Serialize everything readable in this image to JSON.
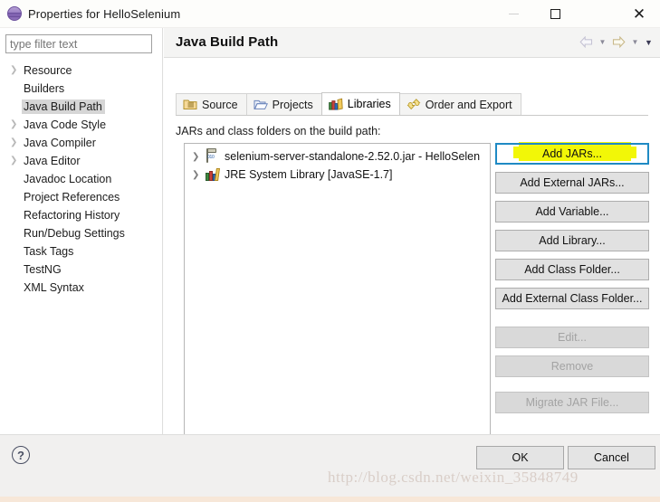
{
  "window": {
    "title": "Properties for HelloSelenium",
    "icon": "eclipse-sphere-icon",
    "minimize_label": "–",
    "maximize_label": "☐",
    "close_label": "✕"
  },
  "sidebar": {
    "filter": {
      "value": "",
      "placeholder": "type filter text"
    },
    "items": [
      {
        "label": "Resource",
        "expandable": true,
        "selected": false
      },
      {
        "label": "Builders",
        "expandable": false,
        "selected": false
      },
      {
        "label": "Java Build Path",
        "expandable": false,
        "selected": true
      },
      {
        "label": "Java Code Style",
        "expandable": true,
        "selected": false
      },
      {
        "label": "Java Compiler",
        "expandable": true,
        "selected": false
      },
      {
        "label": "Java Editor",
        "expandable": true,
        "selected": false
      },
      {
        "label": "Javadoc Location",
        "expandable": false,
        "selected": false
      },
      {
        "label": "Project References",
        "expandable": false,
        "selected": false
      },
      {
        "label": "Refactoring History",
        "expandable": false,
        "selected": false
      },
      {
        "label": "Run/Debug Settings",
        "expandable": false,
        "selected": false
      },
      {
        "label": "Task Tags",
        "expandable": false,
        "selected": false
      },
      {
        "label": "TestNG",
        "expandable": false,
        "selected": false
      },
      {
        "label": "XML Syntax",
        "expandable": false,
        "selected": false
      }
    ]
  },
  "page": {
    "title": "Java Build Path",
    "nav": {
      "back_icon": "back-arrow-icon",
      "back_caret": "▼",
      "forward_icon": "forward-arrow-icon",
      "forward_caret": "▼",
      "menu_caret": "▼"
    }
  },
  "tabs": [
    {
      "label": "Source",
      "icon": "source-folder-icon",
      "active": false
    },
    {
      "label": "Projects",
      "icon": "open-folder-icon",
      "active": false
    },
    {
      "label": "Libraries",
      "icon": "books-icon",
      "active": true
    },
    {
      "label": "Order and Export",
      "icon": "order-arrows-icon",
      "active": false
    }
  ],
  "libraries": {
    "list_label": "JARs and class folders on the build path:",
    "entries": [
      {
        "label": "selenium-server-standalone-2.52.0.jar - HelloSelen",
        "icon": "jar-icon",
        "expandable": true
      },
      {
        "label": "JRE System Library [JavaSE-1.7]",
        "icon": "books-icon",
        "expandable": true
      }
    ],
    "scrollbar": {
      "left_arrow": "‹",
      "right_arrow": "›"
    }
  },
  "buttons": [
    {
      "label": "Add JARs...",
      "enabled": true,
      "focused": true,
      "highlighted": true
    },
    {
      "label": "Add External JARs...",
      "enabled": true,
      "focused": false,
      "highlighted": false
    },
    {
      "label": "Add Variable...",
      "enabled": true,
      "focused": false,
      "highlighted": false
    },
    {
      "label": "Add Library...",
      "enabled": true,
      "focused": false,
      "highlighted": false
    },
    {
      "label": "Add Class Folder...",
      "enabled": true,
      "focused": false,
      "highlighted": false
    },
    {
      "label": "Add External Class Folder...",
      "enabled": true,
      "focused": false,
      "highlighted": false
    },
    {
      "label": "Edit...",
      "enabled": false,
      "focused": false,
      "highlighted": false
    },
    {
      "label": "Remove",
      "enabled": false,
      "focused": false,
      "highlighted": false
    },
    {
      "label": "Migrate JAR File...",
      "enabled": false,
      "focused": false,
      "highlighted": false
    }
  ],
  "footer": {
    "help_icon": "question-mark-icon",
    "help_label": "?",
    "ok_label": "OK",
    "cancel_label": "Cancel"
  },
  "watermark": "http://blog.csdn.net/weixin_35848749",
  "colors": {
    "focus_border": "#1f8ac4",
    "highlight_marker": "#f2f707",
    "selection": "#d6d6d6",
    "panel_header": "#f4f4f3"
  }
}
